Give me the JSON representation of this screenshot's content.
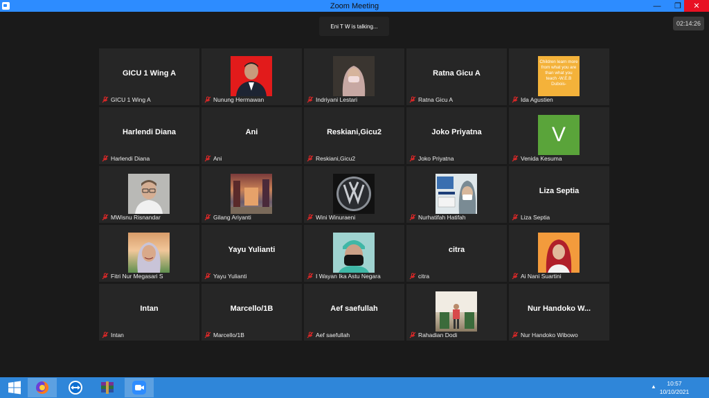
{
  "window": {
    "title": "Zoom Meeting"
  },
  "meeting": {
    "talking_indicator": "Eni T W is talking...",
    "timer": "02:14:26"
  },
  "tiles": [
    {
      "big": "GICU 1 Wing A",
      "label": "GICU 1 Wing A"
    },
    {
      "big": "",
      "label": "Nunung Hermawan",
      "avatar": "man-portrait-red-background"
    },
    {
      "big": "",
      "label": "Indriyani Lestari",
      "avatar": "woman-hijab-mask-photo"
    },
    {
      "big": "Ratna Gicu A",
      "label": "Ratna Gicu A"
    },
    {
      "big": "",
      "label": "Ida Agustien",
      "avatar": "quote-sticky-note",
      "note": "Children learn more from what you are than what you teach -W.E.B Dubois-"
    },
    {
      "big": "Harlendi Diana",
      "label": "Harlendi Diana"
    },
    {
      "big": "Ani",
      "label": "Ani"
    },
    {
      "big": "Reskiani,Gicu2",
      "label": "Reskiani,Gicu2"
    },
    {
      "big": "Joko Priyatna",
      "label": "Joko Priyatna"
    },
    {
      "big": "",
      "label": "Venida Kesuma",
      "avatar": "letter-v-avatar",
      "letter": "V"
    },
    {
      "big": "",
      "label": "MWisnu Risnandar",
      "avatar": "man-glasses-photo"
    },
    {
      "big": "",
      "label": "Gilang Ariyanti",
      "avatar": "city-street-photo"
    },
    {
      "big": "",
      "label": "Wini Winuraeni",
      "avatar": "vw-logo"
    },
    {
      "big": "",
      "label": "Nurhatifah Hatifah",
      "avatar": "ppni-poster-photo"
    },
    {
      "big": "Liza Septia",
      "label": "Liza Septia"
    },
    {
      "big": "",
      "label": "Fitri Nur Megasari S",
      "avatar": "woman-hijab-outdoor-photo"
    },
    {
      "big": "Yayu Yulianti",
      "label": "Yayu Yulianti"
    },
    {
      "big": "",
      "label": "I Wayan Ika Astu Negara",
      "avatar": "surgical-cap-mask-photo"
    },
    {
      "big": "citra",
      "label": "citra"
    },
    {
      "big": "",
      "label": "Ai Nani Suartini",
      "avatar": "woman-red-hijab-photo"
    },
    {
      "big": "Intan",
      "label": "Intan"
    },
    {
      "big": "Marcello/1B",
      "label": "Marcello/1B"
    },
    {
      "big": "Aef saefullah",
      "label": "Aef saefullah"
    },
    {
      "big": "",
      "label": "Rahadian Dodi",
      "avatar": "man-standing-street-photo"
    },
    {
      "big": "Nur Handoko W...",
      "label": "Nur Handoko Wibowo"
    }
  ],
  "taskbar": {
    "items": [
      "windows-start-icon",
      "firefox-icon",
      "teamviewer-icon",
      "winrar-icon",
      "zoom-icon"
    ],
    "clock_time": "10:57",
    "clock_date": "10/10/2021"
  },
  "colors": {
    "titlebar": "#2d8cff",
    "background": "#1a1a1a",
    "tile": "#262626",
    "muted_mic": "#e02828",
    "taskbar": "#2f86d9"
  }
}
